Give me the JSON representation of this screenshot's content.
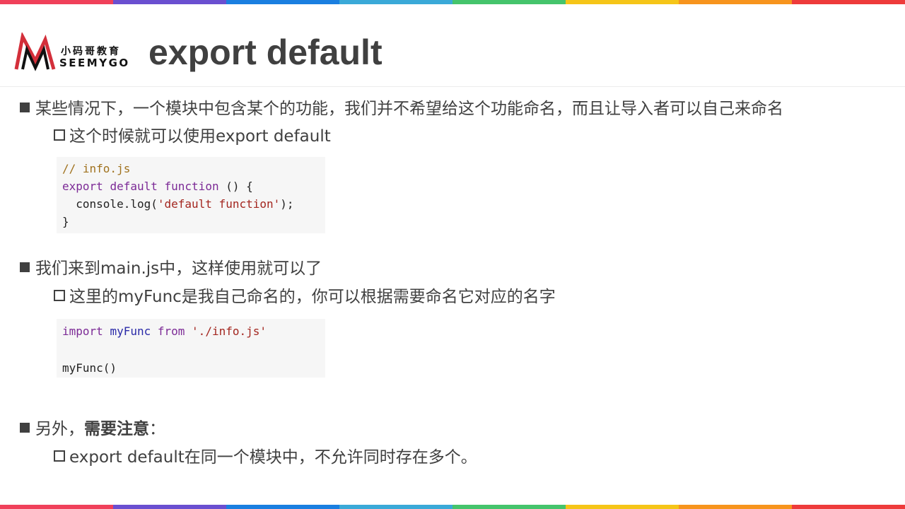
{
  "stripe_colors": [
    "#f0405a",
    "#6a4fd0",
    "#1a7fe0",
    "#3aa9d8",
    "#45c46c",
    "#f5c518",
    "#f7941d",
    "#ee3b3b"
  ],
  "logo": {
    "cn": "小码哥教育",
    "en": "SEEMYGO"
  },
  "title": "export default",
  "items": [
    {
      "text": "某些情况下，一个模块中包含某个的功能，我们并不希望给这个功能命名，而且让导入者可以自己来命名",
      "sub": "这个时候就可以使用export default"
    },
    {
      "text": "我们来到main.js中，这样使用就可以了",
      "sub": "这里的myFunc是我自己命名的，你可以根据需要命名它对应的名字"
    },
    {
      "text_prefix": "另外，",
      "text_strong": "需要注意",
      "text_suffix": "：",
      "sub": "export default在同一个模块中，不允许同时存在多个。"
    }
  ],
  "code1": {
    "comment": "// info.js",
    "kw_export": "export",
    "kw_default": "default",
    "kw_function": "function",
    "sig_rest": " () {",
    "call_prefix": "  console.log(",
    "call_str": "'default function'",
    "call_suffix": ");",
    "close": "}"
  },
  "code2": {
    "kw_import": "import",
    "ident": "myFunc",
    "kw_from": "from",
    "path": "'./info.js'",
    "call": "myFunc()"
  }
}
